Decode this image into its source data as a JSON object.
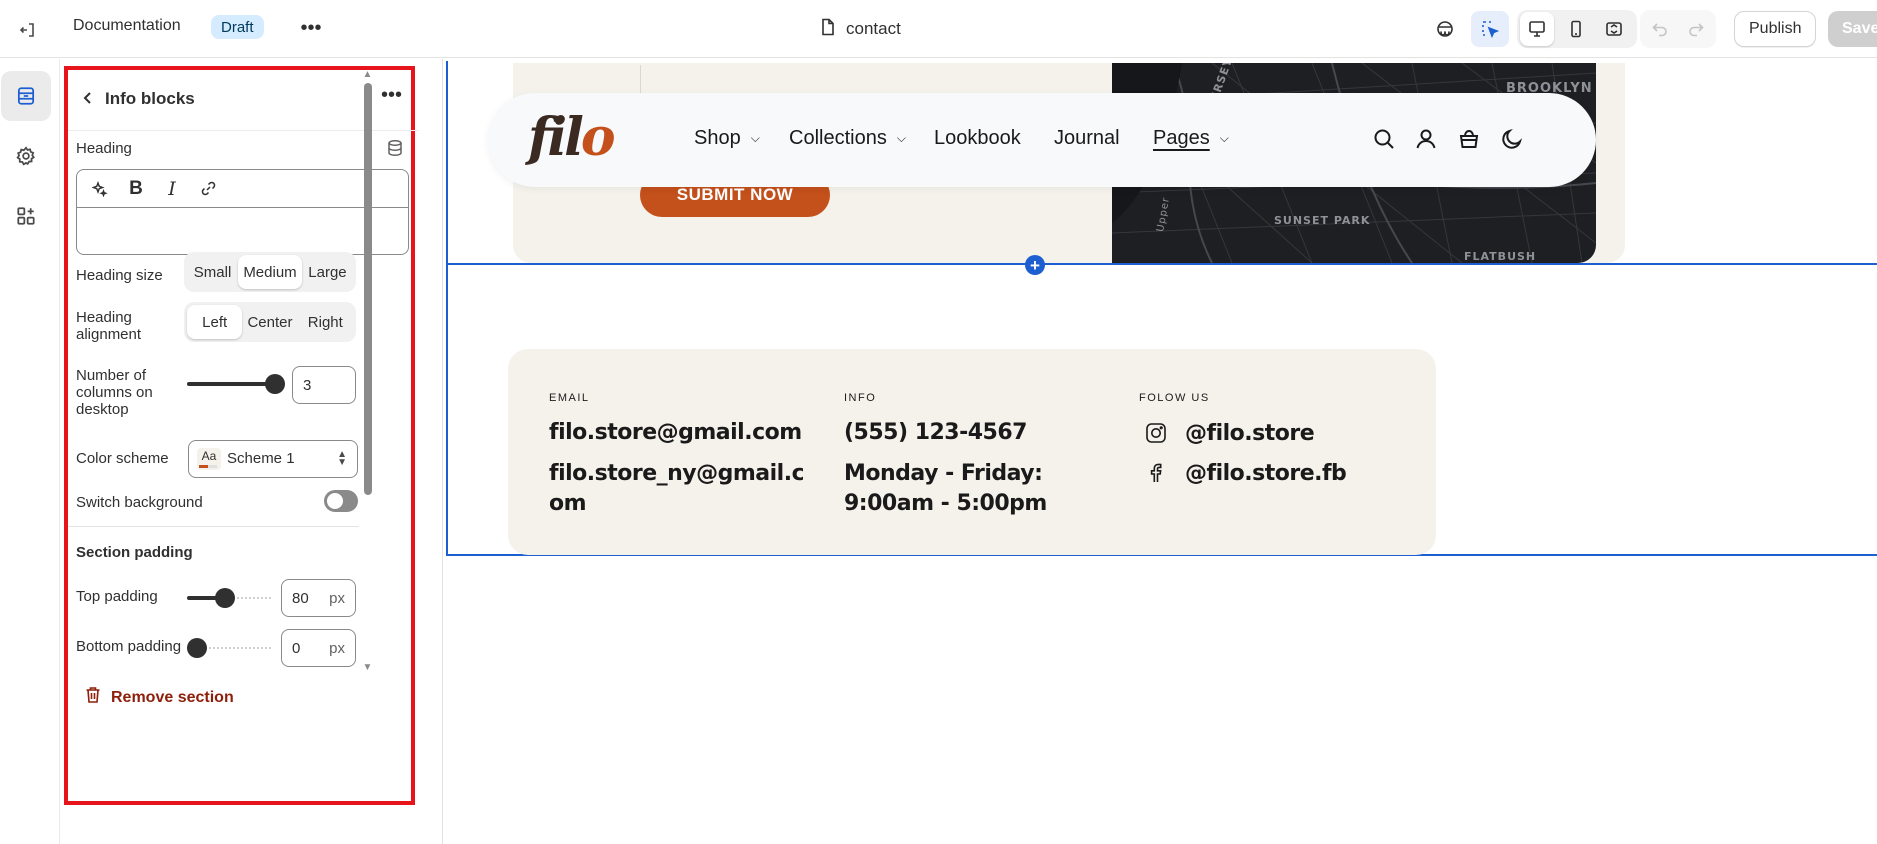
{
  "topbar": {
    "title": "Documentation",
    "status_badge": "Draft",
    "page_name": "contact",
    "publish_label": "Publish",
    "save_label": "Save"
  },
  "panel": {
    "title": "Info blocks",
    "heading_label": "Heading",
    "heading_value": "",
    "heading_size": {
      "label": "Heading size",
      "options": [
        "Small",
        "Medium",
        "Large"
      ],
      "selected": "Medium"
    },
    "heading_alignment": {
      "label_line1": "Heading",
      "label_line2": "alignment",
      "options": [
        "Left",
        "Center",
        "Right"
      ],
      "selected": "Left"
    },
    "columns": {
      "label_line1": "Number of",
      "label_line2": "columns on",
      "label_line3": "desktop",
      "value": "3",
      "fraction": 1.0
    },
    "color_scheme": {
      "label": "Color scheme",
      "swatch_text": "Aa",
      "value": "Scheme 1"
    },
    "switch_background": {
      "label": "Switch background",
      "on": false
    },
    "section_padding": {
      "heading": "Section padding",
      "top": {
        "label": "Top padding",
        "value": "80",
        "unit": "px",
        "fraction": 0.4
      },
      "bottom": {
        "label": "Bottom padding",
        "value": "0",
        "unit": "px",
        "fraction": 0.0
      }
    },
    "remove_label": "Remove section"
  },
  "preview": {
    "logo_left": "fil",
    "logo_right": "o",
    "submit_label": "SUBMIT NOW",
    "map_labels": [
      "BROOKLYN",
      "SUNSET PARK",
      "FLATBUSH",
      "JERSEY",
      "Upper"
    ],
    "nav": [
      {
        "label": "Shop",
        "has_dropdown": true
      },
      {
        "label": "Collections",
        "has_dropdown": true
      },
      {
        "label": "Lookbook",
        "has_dropdown": false
      },
      {
        "label": "Journal",
        "has_dropdown": false
      },
      {
        "label": "Pages",
        "has_dropdown": true
      }
    ],
    "cards": [
      {
        "label": "EMAIL",
        "lines": [
          "filo.store@gmail.com",
          "filo.store_ny@gmail.c",
          "om"
        ]
      },
      {
        "label": "INFO",
        "lines": [
          "(555) 123-4567",
          "Monday - Friday:",
          "9:00am - 5:00pm"
        ]
      },
      {
        "label": "FOLOW US",
        "social": [
          {
            "icon": "instagram-icon",
            "handle": "@filo.store"
          },
          {
            "icon": "facebook-icon",
            "handle": "@filo.store.fb"
          }
        ]
      }
    ]
  },
  "colors": {
    "accent": "#1d5fd1",
    "brand": "#c4501b",
    "highlight": "#e8141b",
    "card_bg": "#f5f2ec"
  }
}
